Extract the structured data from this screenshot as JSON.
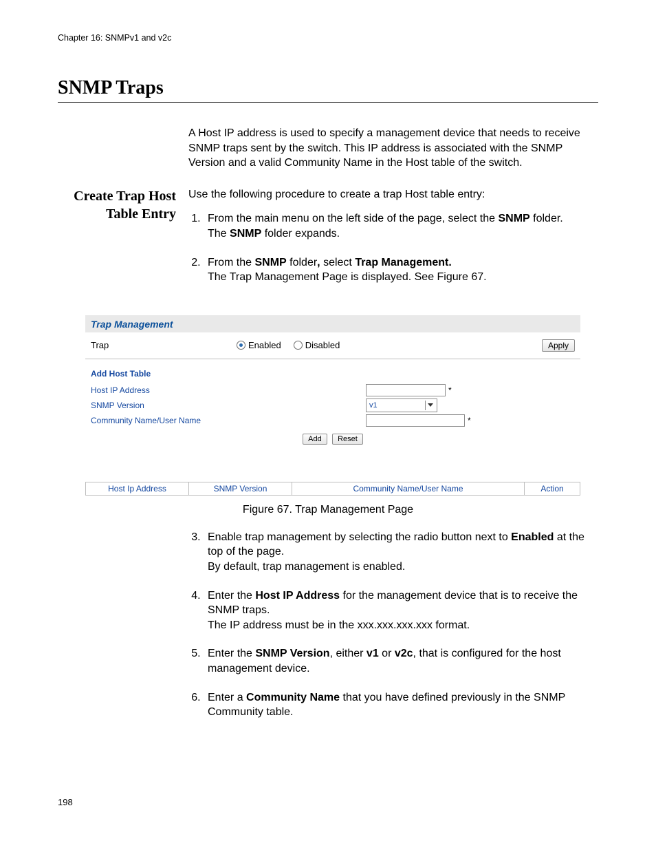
{
  "chapter_line": "Chapter 16: SNMPv1 and v2c",
  "main_heading": "SNMP Traps",
  "intro_paragraph": "A Host IP address is used to specify a management device that needs to receive SNMP traps sent by the switch. This IP address is associated with the SNMP Version and a valid Community Name in the Host table of the switch.",
  "side_heading": "Create Trap Host Table Entry",
  "proc_intro": "Use the following procedure to create a trap Host table entry:",
  "steps": {
    "s1a": "From the main menu on the left side of the page, select the ",
    "s1_bold1": "SNMP",
    "s1b": " folder.",
    "s1c_prefix": "The ",
    "s1c_bold": "SNMP",
    "s1c_suffix": " folder expands.",
    "s2a": "From the ",
    "s2_bold1": "SNMP",
    "s2b": " folder",
    "s2_bold_comma": ",",
    "s2c": " select ",
    "s2_bold2": "Trap Management.",
    "s2d": "The Trap Management Page is displayed. See Figure 67.",
    "s3a": "Enable trap management by selecting the radio button next to ",
    "s3_bold": "Enabled",
    "s3b": " at the top of the page.",
    "s3c": "By default, trap management is enabled.",
    "s4a": "Enter the ",
    "s4_bold": "Host IP Address",
    "s4b": " for the management device that is to receive the SNMP traps.",
    "s4c": "The IP address must be in the xxx.xxx.xxx.xxx format.",
    "s5a": "Enter the ",
    "s5_bold1": "SNMP Version",
    "s5b": ", either ",
    "s5_bold2": "v1",
    "s5c": " or ",
    "s5_bold3": "v2c",
    "s5d": ", that is configured for the host management device.",
    "s6a": "Enter a ",
    "s6_bold": "Community Name",
    "s6b": " that you have defined previously in the SNMP Community table."
  },
  "figure": {
    "panel_title": "Trap Management",
    "trap_label": "Trap",
    "enabled_label": "Enabled",
    "disabled_label": "Disabled",
    "apply_label": "Apply",
    "add_host_title": "Add Host Table",
    "host_ip_label": "Host IP Address",
    "snmp_version_label": "SNMP Version",
    "snmp_version_value": "v1",
    "community_label": "Community Name/User Name",
    "req_mark": "*",
    "add_btn": "Add",
    "reset_btn": "Reset",
    "col_hostip": "Host Ip Address",
    "col_snmpver": "SNMP Version",
    "col_comm": "Community Name/User Name",
    "col_action": "Action",
    "caption": "Figure 67. Trap Management Page"
  },
  "page_number": "198"
}
